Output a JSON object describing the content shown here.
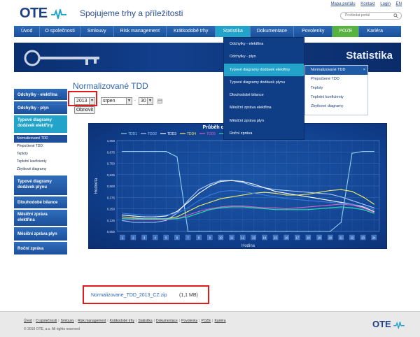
{
  "header": {
    "logo_text": "OTE",
    "tagline": "Spojujeme trhy a příležitosti",
    "utility_links": [
      "Mapa portálu",
      "Kontakt",
      "Login",
      "EN"
    ],
    "search_placeholder": "Prohledat portál"
  },
  "topnav": {
    "items": [
      "Úvod",
      "O společnosti",
      "Smlouvy",
      "Risk management",
      "Krátkodobé trhy",
      "Statistika",
      "Dokumentace",
      "Povolenky",
      "POZE",
      "Kariéra"
    ],
    "active": "Statistika",
    "highlight": "POZE"
  },
  "banner": {
    "title": "Statistika"
  },
  "dropdown": {
    "items": [
      "Odchylky - elektřina",
      "Odchylky - plyn",
      "Typové diagramy dodávek elektřiny",
      "Typové diagramy dodávek plynu",
      "Dlouhodobé bilance",
      "Měsíční zpráva elektřina",
      "Měsíční zpráva plyn",
      "Roční zpráva"
    ],
    "highlighted": "Typové diagramy dodávek elektřiny"
  },
  "subdropdown": {
    "items": [
      "Normalizované TDD",
      "Přepočtené TDD",
      "Teploty",
      "Teplotní koeficienty",
      "Zbytkové diagramy"
    ],
    "highlighted": "Normalizované TDD",
    "close_glyph": "×"
  },
  "page": {
    "title": "Normalizované TDD"
  },
  "controls": {
    "year": "2013",
    "month": "srpen",
    "separator": ".",
    "day": "30",
    "refresh_label": "Obnovit"
  },
  "sidebar": {
    "items": [
      {
        "label": "Odchylky - elektřina"
      },
      {
        "label": "Odchylky - plyn"
      },
      {
        "label": "Typové diagramy dodávek elektřiny",
        "open": true,
        "sub": [
          "Normalizované TDD",
          "Přepočtené TDD",
          "Teploty",
          "Teplotní koeficienty",
          "Zbytkové diagramy"
        ]
      },
      {
        "label": "Typové diagramy dodávek plynu"
      },
      {
        "label": "Dlouhodobé bilance"
      },
      {
        "label": "Měsíční zpráva elektřina"
      },
      {
        "label": "Měsíční zpráva plyn"
      },
      {
        "label": "Roční zpráva"
      }
    ]
  },
  "download": {
    "file_name": "Normalizovane_TDD_2013_CZ.zip",
    "size": "(1,1 MB)"
  },
  "footer": {
    "links": [
      "Úvod",
      "O společnosti",
      "Smlouvy",
      "Risk management",
      "Krátkodobé trhy",
      "Statistika",
      "Dokumentace",
      "Povolenky",
      "POZE",
      "Kariéra"
    ],
    "copyright": "© 2010 OTE, a.s. All rights reserved",
    "logo_text": "OTE"
  },
  "colors": {
    "nav_blue": "#1b4f98",
    "active_cyan": "#22a3c9",
    "poze_green": "#55b33e",
    "highlight_red": "#e11b1b"
  },
  "chart_data": {
    "type": "line",
    "title": "Průběh celostátních no… 2013",
    "xlabel": "Hodina",
    "ylabel": "Hodnota",
    "ylim": [
      0,
      1
    ],
    "yticks": [
      "0,000",
      "0,125",
      "0,250",
      "0,375",
      "0,500",
      "0,625",
      "0,750",
      "0,875",
      "1,000"
    ],
    "categories": [
      "1",
      "2",
      "3",
      "4",
      "5",
      "6",
      "7",
      "8",
      "9",
      "10",
      "11",
      "12",
      "13",
      "14",
      "15",
      "16",
      "17",
      "18",
      "19",
      "20",
      "21",
      "22",
      "23",
      "24"
    ],
    "series": [
      {
        "name": "TDD1",
        "color": "#8fd3f0",
        "values": [
          0.88,
          0.88,
          0.88,
          0.88,
          0.88,
          0.82,
          0,
          0,
          0,
          0,
          0,
          0,
          0,
          0,
          0,
          0,
          0,
          0,
          0,
          0,
          0.1,
          0.86,
          0.88,
          0.88
        ]
      },
      {
        "name": "TDD2",
        "color": "#a9c8ff",
        "values": [
          0.12,
          0.1,
          0.1,
          0.1,
          0.12,
          0.2,
          0.34,
          0.46,
          0.52,
          0.56,
          0.56,
          0.54,
          0.5,
          0.48,
          0.46,
          0.45,
          0.44,
          0.43,
          0.42,
          0.41,
          0.38,
          0.34,
          0.3,
          0.26
        ]
      },
      {
        "name": "TDD3",
        "color": "#ffffff",
        "values": [
          0.18,
          0.17,
          0.16,
          0.16,
          0.17,
          0.22,
          0.32,
          0.42,
          0.5,
          0.55,
          0.56,
          0.55,
          0.52,
          0.48,
          0.44,
          0.42,
          0.4,
          0.38,
          0.36,
          0.34,
          0.32,
          0.3,
          0.27,
          0.22
        ]
      },
      {
        "name": "TDD4",
        "color": "#f3ef6a",
        "values": [
          0.16,
          0.15,
          0.14,
          0.14,
          0.14,
          0.16,
          0.22,
          0.28,
          0.32,
          0.36,
          0.38,
          0.4,
          0.42,
          0.43,
          0.42,
          0.4,
          0.4,
          0.41,
          0.43,
          0.45,
          0.46,
          0.44,
          0.38,
          0.3
        ]
      },
      {
        "name": "TDD5",
        "color": "#d062c7",
        "values": [
          0.14,
          0.13,
          0.13,
          0.13,
          0.13,
          0.14,
          0.18,
          0.22,
          0.25,
          0.27,
          0.28,
          0.28,
          0.27,
          0.26,
          0.26,
          0.25,
          0.26,
          0.27,
          0.28,
          0.29,
          0.3,
          0.29,
          0.26,
          0.21
        ]
      },
      {
        "name": "TDD6",
        "color": "#2ee0b0",
        "values": [
          0.14,
          0.14,
          0.14,
          0.14,
          0.14,
          0.14,
          0.16,
          0.2,
          0.24,
          0.26,
          0.27,
          0.27,
          0.26,
          0.25,
          0.24,
          0.24,
          0.24,
          0.24,
          0.25,
          0.26,
          0.27,
          0.26,
          0.24,
          0.2
        ]
      },
      {
        "name": "TDD7",
        "color": "#3a7ee0",
        "values": [
          0.2,
          0.19,
          0.18,
          0.18,
          0.18,
          0.2,
          0.26,
          0.34,
          0.4,
          0.44,
          0.45,
          0.44,
          0.42,
          0.4,
          0.38,
          0.36,
          0.35,
          0.34,
          0.33,
          0.32,
          0.31,
          0.3,
          0.28,
          0.24
        ]
      }
    ],
    "legend_placement": "top"
  }
}
